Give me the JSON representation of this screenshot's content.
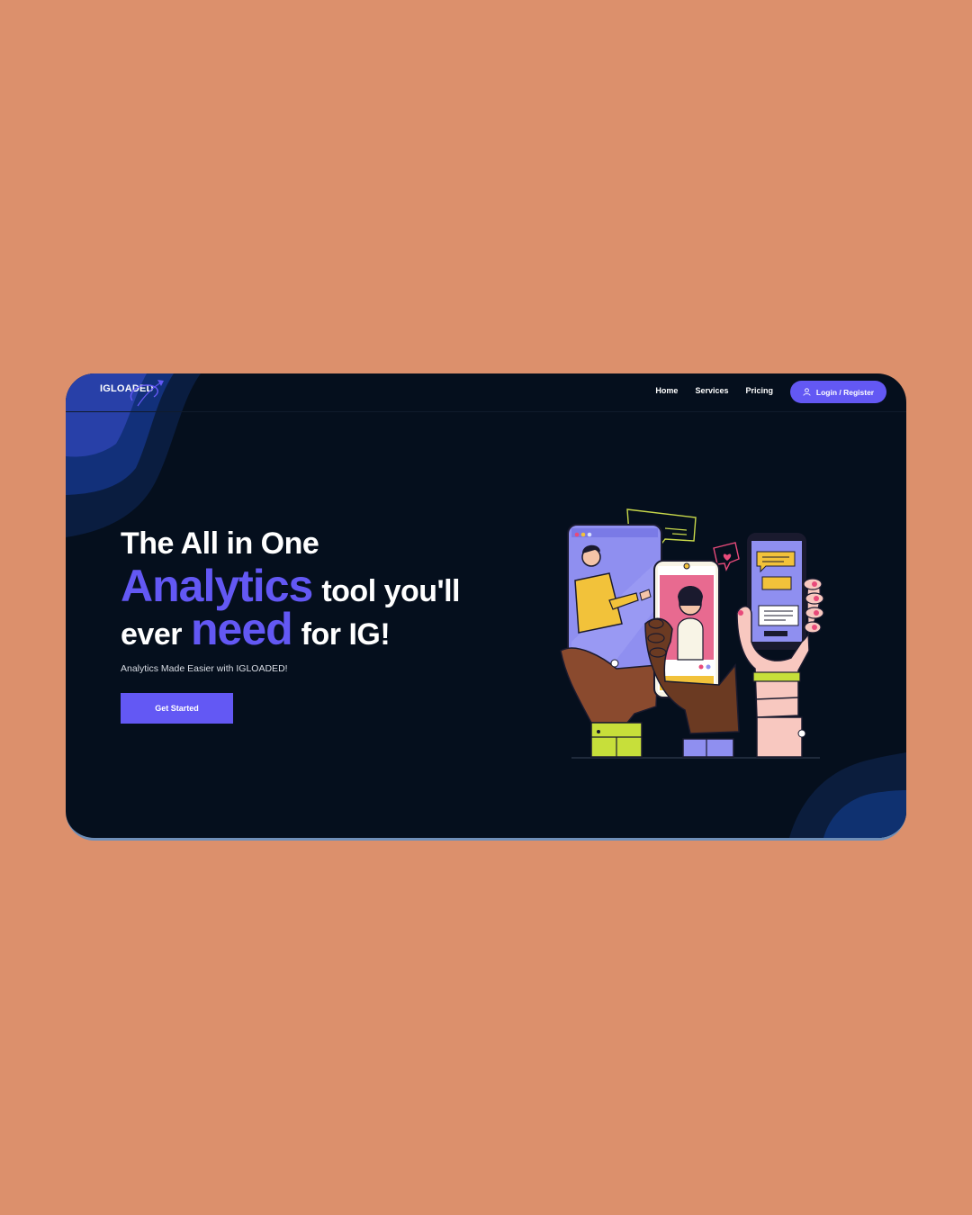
{
  "brand": {
    "logo_text": "IGLOADED"
  },
  "nav": {
    "links": [
      "Home",
      "Services",
      "Pricing"
    ],
    "login_label": "Login / Register"
  },
  "hero": {
    "line1": "The All in One",
    "accent1": "Analytics",
    "rest1": "tool you'll",
    "pre2": "ever",
    "accent2": "need",
    "rest2": "for IG!",
    "subtitle": "Analytics Made Easier with IGLOADED!",
    "cta_label": "Get Started"
  },
  "colors": {
    "page_background": "#dc906c",
    "card_background": "#050f1d",
    "accent": "#6358f4"
  },
  "icons": [
    "user-icon",
    "orbit-arrow-icon"
  ]
}
